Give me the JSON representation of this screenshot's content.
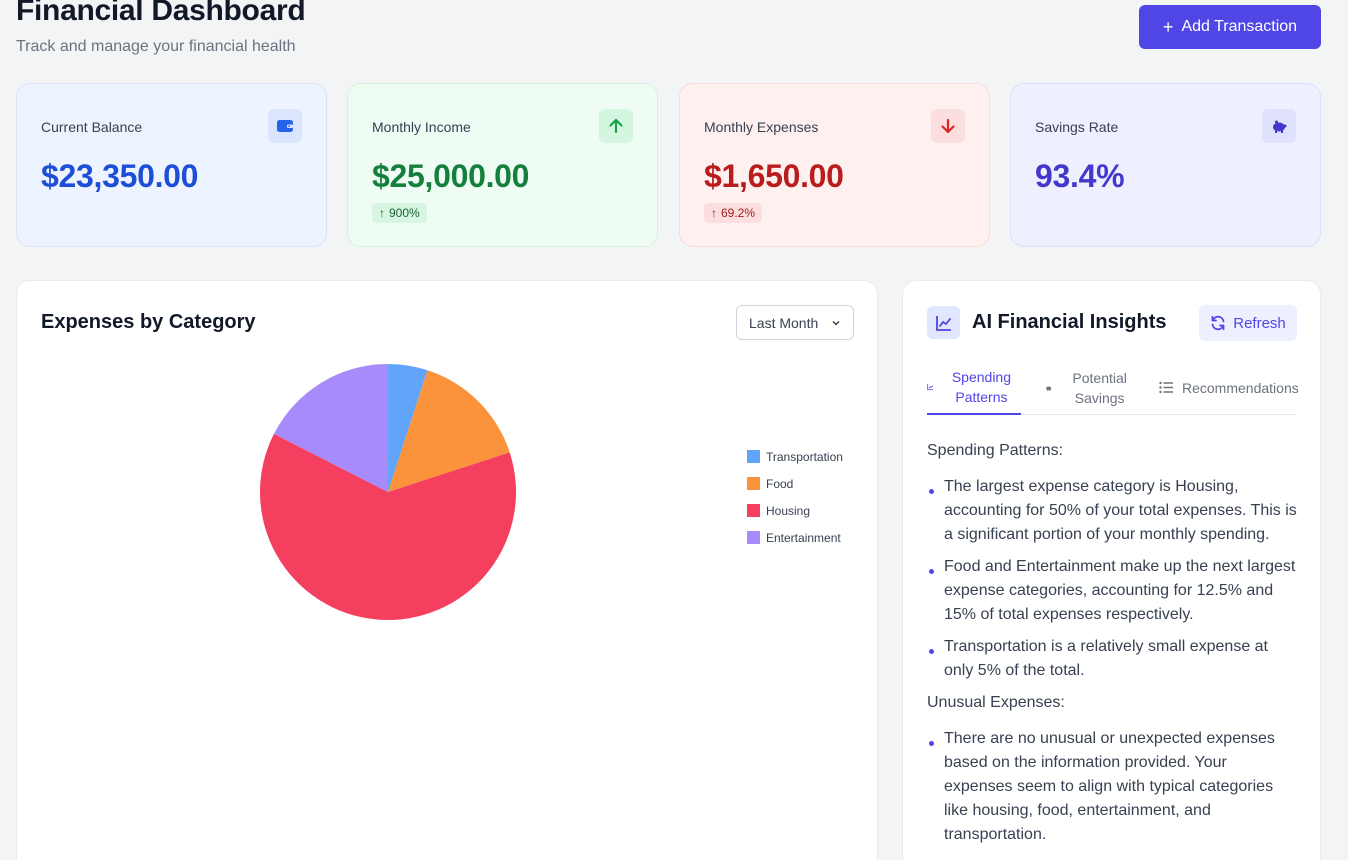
{
  "header": {
    "title": "Financial Dashboard",
    "subtitle": "Track and manage your financial health",
    "add_button": "Add Transaction"
  },
  "cards": {
    "balance": {
      "label": "Current Balance",
      "value": "$23,350.00",
      "icon": "wallet-icon"
    },
    "income": {
      "label": "Monthly Income",
      "value": "$25,000.00",
      "change": "900%",
      "icon": "arrow-up-icon"
    },
    "expenses": {
      "label": "Monthly Expenses",
      "value": "$1,650.00",
      "change": "69.2%",
      "icon": "arrow-down-icon"
    },
    "savings": {
      "label": "Savings Rate",
      "value": "93.4%",
      "icon": "piggy-bank-icon"
    }
  },
  "expenses_chart": {
    "title": "Expenses by Category",
    "period": "Last Month"
  },
  "chart_data": {
    "type": "pie",
    "title": "",
    "categories": [
      "Transportation",
      "Food",
      "Housing",
      "Entertainment"
    ],
    "values": [
      5,
      15,
      62.5,
      17.5
    ],
    "colors": [
      "#60a5fa",
      "#fb923c",
      "#f43f5e",
      "#a78bfa"
    ],
    "legend": "right"
  },
  "insights": {
    "title": "AI Financial Insights",
    "refresh_label": "Refresh",
    "tabs": [
      {
        "label": "Spending Patterns",
        "icon": "chart-line-icon",
        "active": true
      },
      {
        "label": "Potential Savings",
        "icon": "piggy-bank-icon",
        "active": false
      },
      {
        "label": "Recommendations",
        "icon": "list-icon",
        "active": false
      }
    ],
    "sections": [
      {
        "heading": "Spending Patterns:",
        "items": [
          "The largest expense category is Housing, accounting for 50% of your total expenses. This is a significant portion of your monthly spending.",
          "Food and Entertainment make up the next largest expense categories, accounting for 12.5% and 15% of total expenses respectively.",
          "Transportation is a relatively small expense at only 5% of the total."
        ]
      },
      {
        "heading": "Unusual Expenses:",
        "items": [
          "There are no unusual or unexpected expenses based on the information provided. Your expenses seem to align with typical categories like housing, food, entertainment, and transportation."
        ]
      }
    ]
  }
}
